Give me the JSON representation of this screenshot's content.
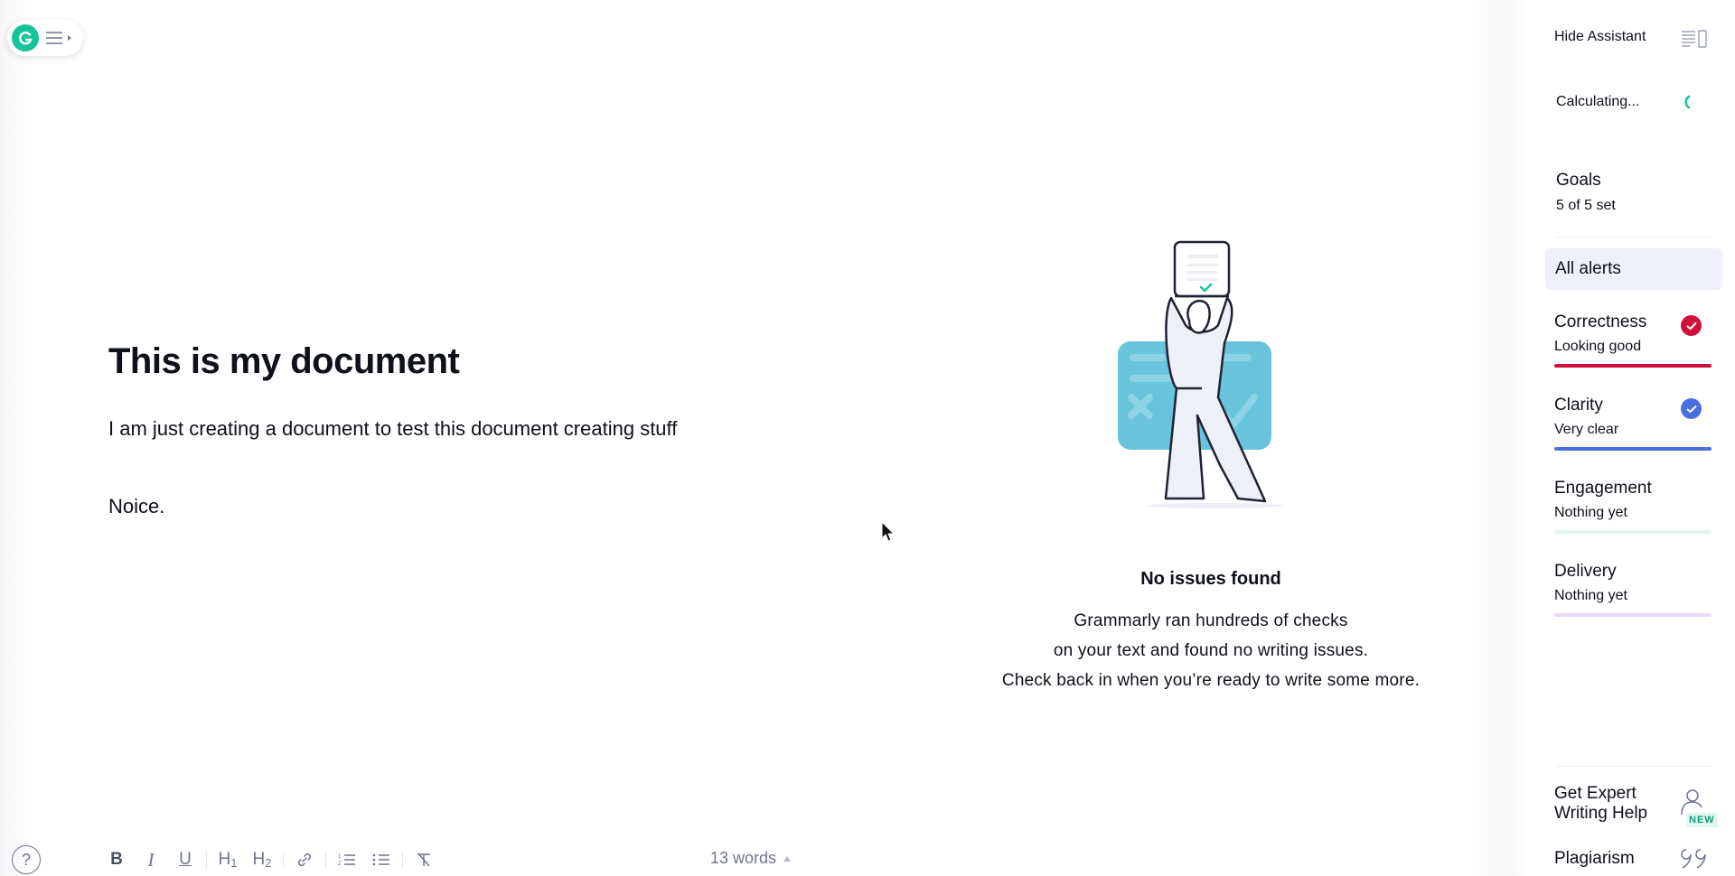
{
  "grammarly_button": {
    "logo": "grammarly-g-icon",
    "menu_icon": "hamburger-icon"
  },
  "document": {
    "title": "This is my document",
    "paragraphs": [
      "I am just creating a document to test this document creating stuff",
      "Noice."
    ]
  },
  "empty_state": {
    "title": "No issues found",
    "lines": [
      "Grammarly ran hundreds of checks",
      "on your text and found no writing issues.",
      "Check back in when you’re ready to write some more."
    ],
    "illustration": "person-holding-document-illustration"
  },
  "toolbar": {
    "help": "?",
    "bold": "B",
    "italic": "I",
    "underline": "U",
    "h1": "H",
    "h1_sub": "1",
    "h2": "H",
    "h2_sub": "2",
    "word_count": "13 words"
  },
  "sidebar": {
    "hide_assistant": "Hide Assistant",
    "score_status": "Calculating...",
    "goals_title": "Goals",
    "goals_sub": "5 of 5 set",
    "all_alerts": "All alerts",
    "categories": [
      {
        "name": "Correctness",
        "status": "Looking good",
        "color": "#d0103a",
        "checked": true
      },
      {
        "name": "Clarity",
        "status": "Very clear",
        "color": "#4a6ee0",
        "checked": true
      },
      {
        "name": "Engagement",
        "status": "Nothing yet",
        "color": "#dff5ee",
        "checked": false
      },
      {
        "name": "Delivery",
        "status": "Nothing yet",
        "color": "#ead9f5",
        "checked": false
      }
    ],
    "expert_help": "Get Expert Writing Help",
    "new_badge": "NEW",
    "plagiarism": "Plagiarism"
  },
  "colors": {
    "brand": "#15c39a",
    "text": "#0e101a",
    "muted": "#6d758d"
  }
}
